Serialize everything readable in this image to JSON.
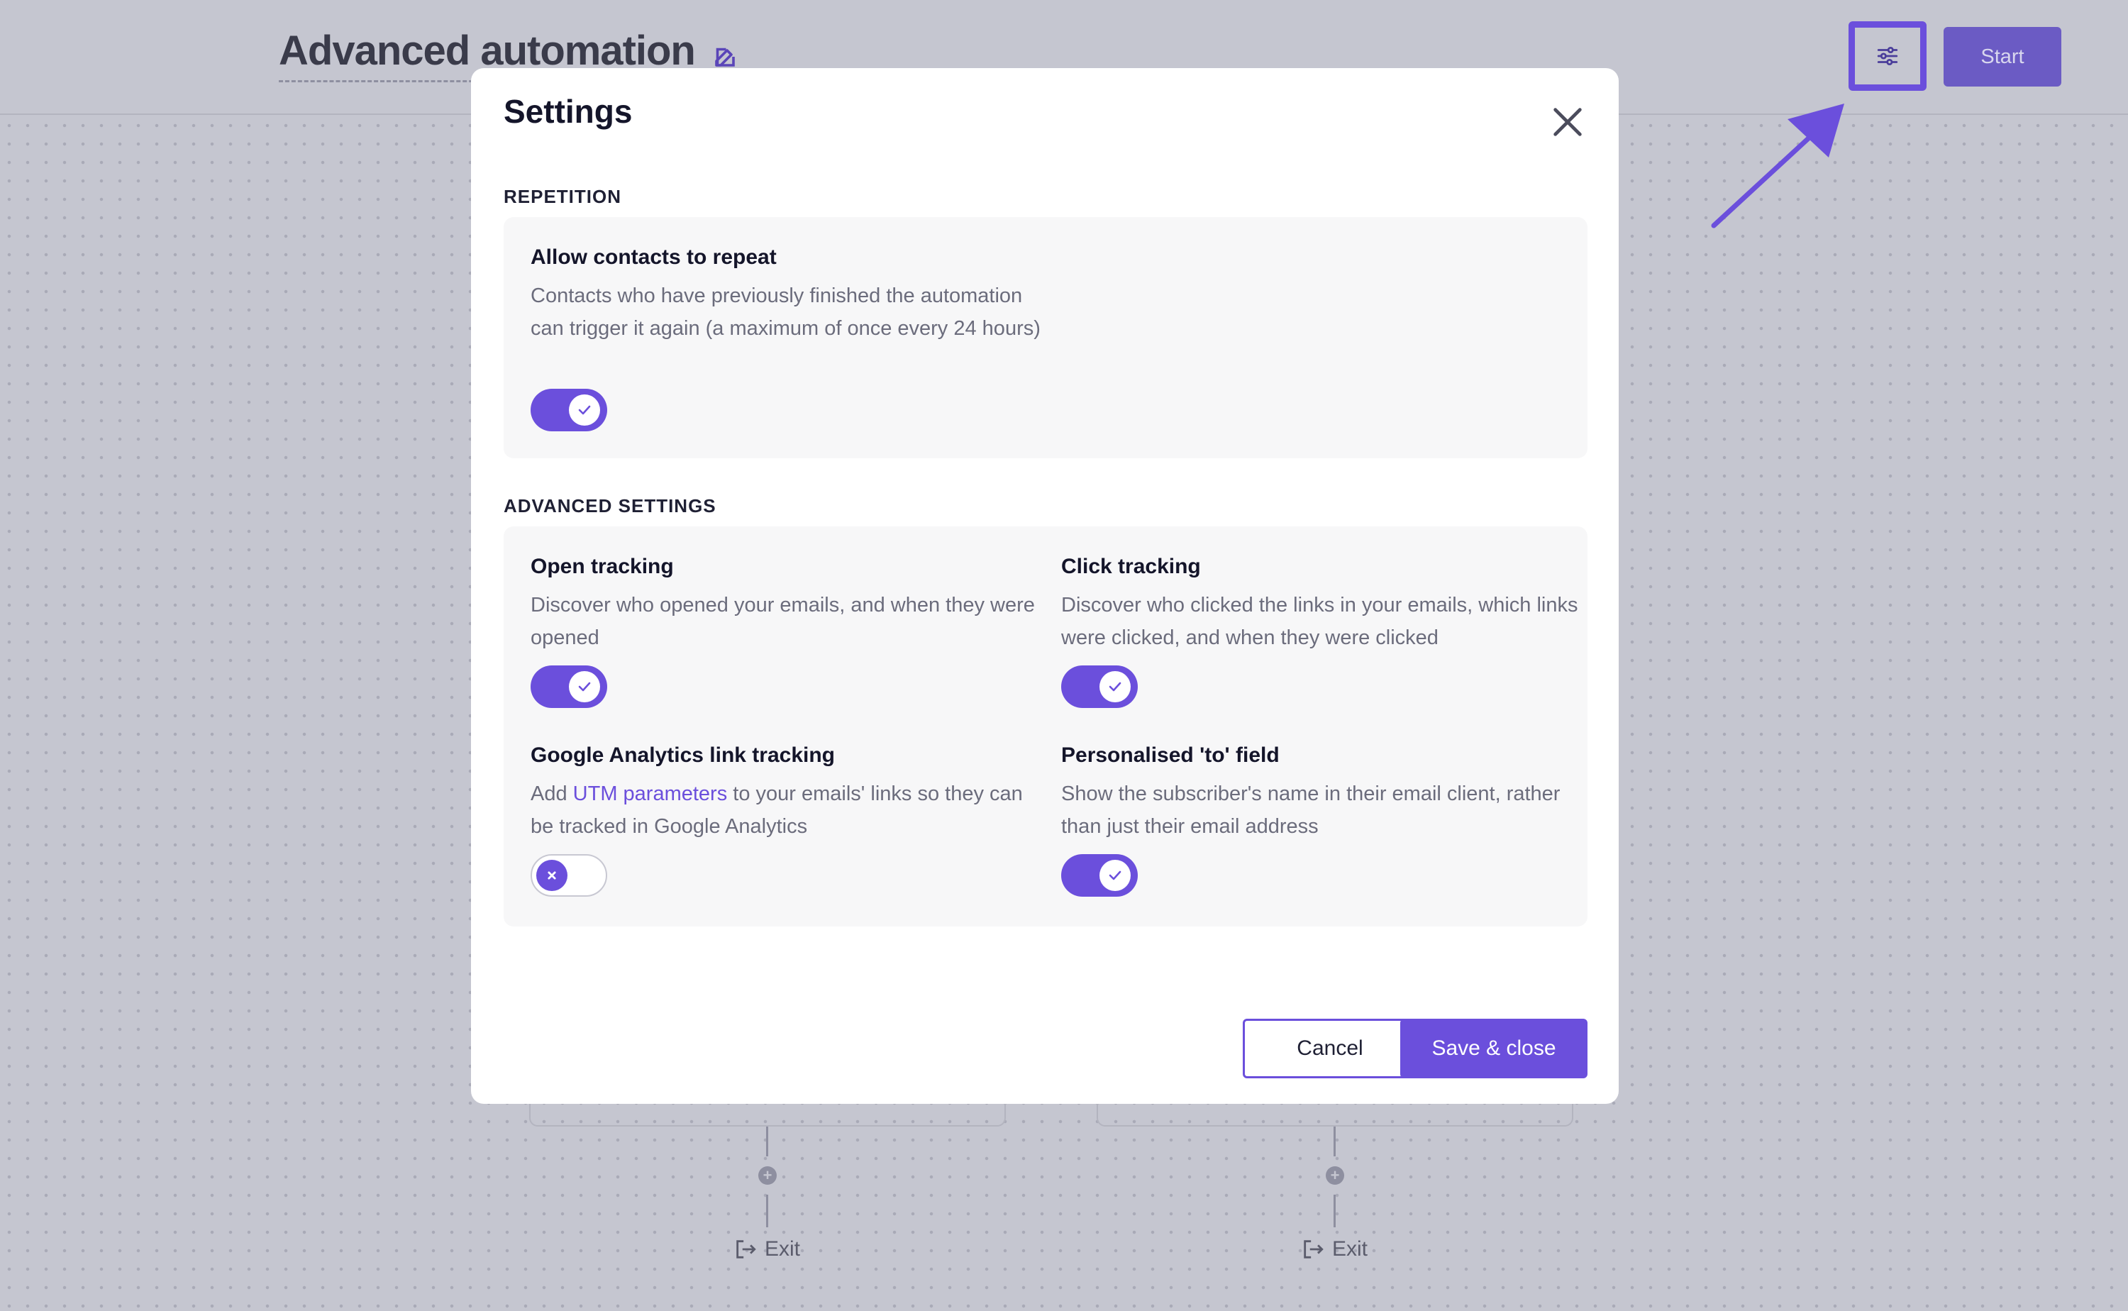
{
  "header": {
    "title": "Advanced automation",
    "start_label": "Start"
  },
  "flow": {
    "exit_label": "Exit"
  },
  "modal": {
    "title": "Settings",
    "repetition": {
      "section_label": "REPETITION",
      "allow_repeat": {
        "title": "Allow contacts to repeat",
        "description": "Contacts who have previously finished the automation can trigger it again (a maximum of once every 24 hours)",
        "enabled": true
      }
    },
    "advanced": {
      "section_label": "ADVANCED SETTINGS",
      "open_tracking": {
        "title": "Open tracking",
        "description": "Discover who opened your emails, and when they were opened",
        "enabled": true
      },
      "click_tracking": {
        "title": "Click tracking",
        "description": "Discover who clicked the links in your emails, which links were clicked, and when they were clicked",
        "enabled": true
      },
      "ga_tracking": {
        "title": "Google Analytics link tracking",
        "desc_prefix": "Add ",
        "desc_link": "UTM parameters",
        "desc_suffix": " to your emails' links so they can be tracked in Google Analytics",
        "enabled": false
      },
      "personalised_to": {
        "title": "Personalised 'to' field",
        "description": "Show the subscriber's name in their email client, rather than just their email address",
        "enabled": true
      }
    },
    "cancel_label": "Cancel",
    "save_label": "Save & close"
  },
  "colors": {
    "accent": "#6b4fdc",
    "backdrop": "#c5c6d0"
  }
}
